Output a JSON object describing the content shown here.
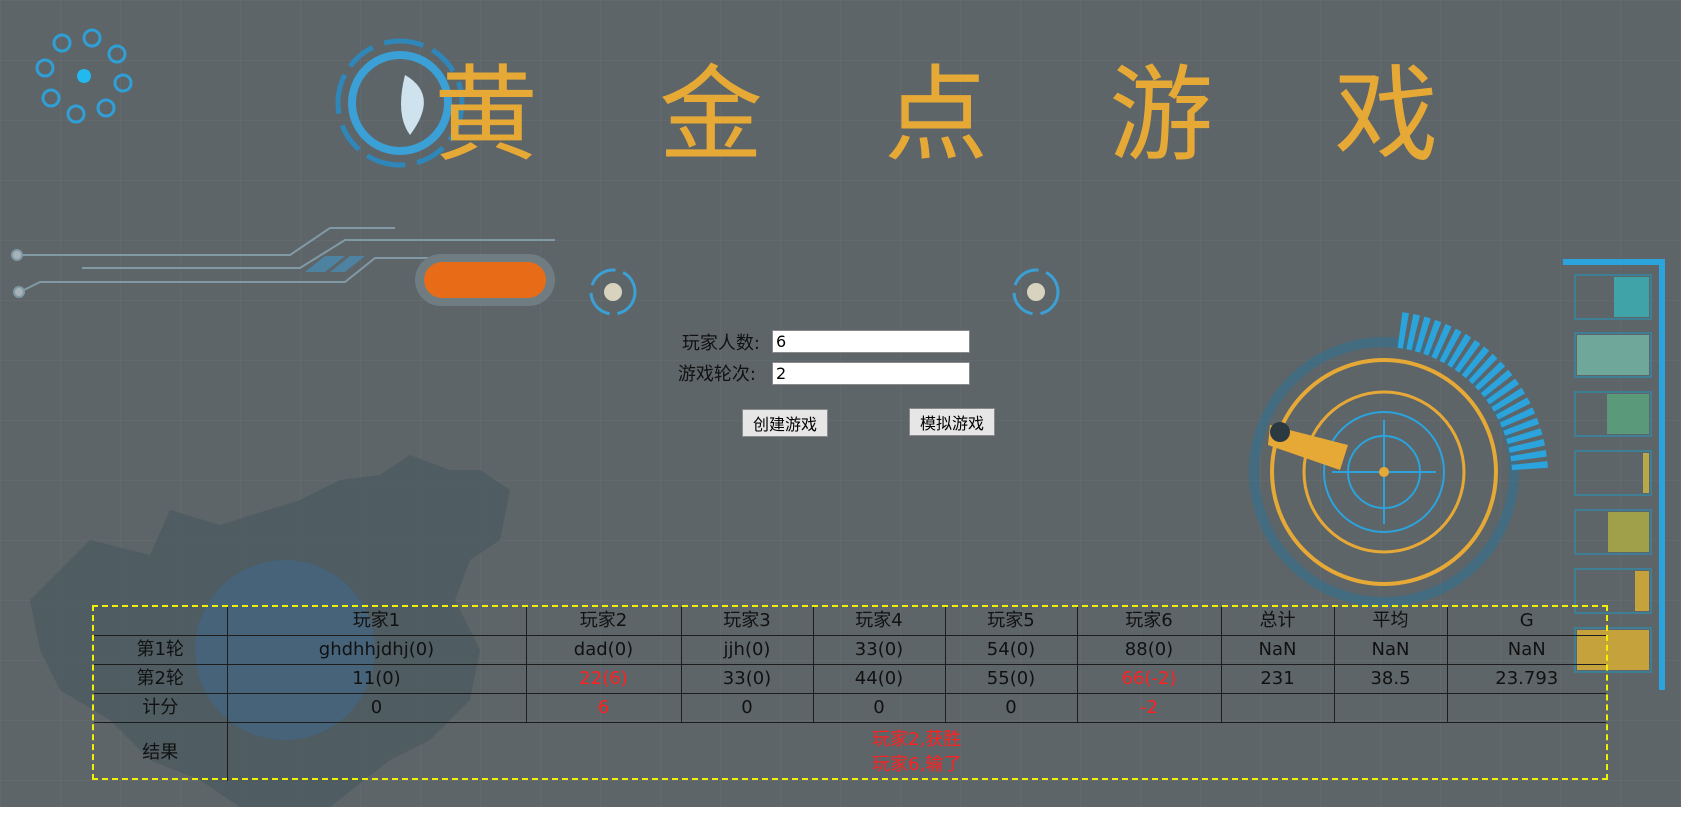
{
  "title": "黄 金 点 游 戏",
  "form": {
    "players_label": "玩家人数:",
    "players_value": "6",
    "rounds_label": "游戏轮次:",
    "rounds_value": "2",
    "create_button": "创建游戏",
    "simulate_button": "模拟游戏"
  },
  "table": {
    "header": [
      "",
      "玩家1",
      "玩家2",
      "玩家3",
      "玩家4",
      "玩家5",
      "玩家6",
      "总计",
      "平均",
      "G"
    ],
    "rows": [
      [
        "第1轮",
        "ghdhhjdhj(0)",
        "dad(0)",
        "jjh(0)",
        "33(0)",
        "54(0)",
        "88(0)",
        "NaN",
        "NaN",
        "NaN"
      ],
      [
        "第2轮",
        "11(0)",
        "22(6)",
        "33(0)",
        "44(0)",
        "55(0)",
        "66(-2)",
        "231",
        "38.5",
        "23.793"
      ],
      [
        "计分",
        "0",
        "6",
        "0",
        "0",
        "0",
        "-2",
        "",
        "",
        ""
      ]
    ],
    "result_label": "结果",
    "result_lines": [
      "玩家2,获胜",
      "玩家6,输了"
    ]
  },
  "colors": {
    "background": "#5d6568",
    "title": "#e7a936",
    "highlight_red": "#ff2020",
    "dashed_border": "#f2f200"
  },
  "decor_icons": [
    "dots-ring-icon",
    "radar-gauge-icon",
    "china-map-background",
    "circuit-lines-decoration",
    "level-bars-decoration"
  ]
}
